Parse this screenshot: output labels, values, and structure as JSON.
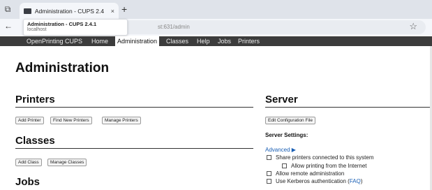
{
  "browser": {
    "tab_title": "Administration - CUPS 2.4",
    "tab_close": "×",
    "new_tab": "+",
    "tooltip_title": "Administration - CUPS 2.4.1",
    "tooltip_host": "localhost",
    "url_visible": "st:631/admin",
    "back": "←",
    "star": "☆",
    "overview": "⧉"
  },
  "nav": {
    "brand": "OpenPrinting CUPS",
    "items": [
      "Home",
      "Administration",
      "Classes",
      "Help",
      "Jobs",
      "Printers"
    ]
  },
  "page": {
    "title": "Administration"
  },
  "printers": {
    "heading": "Printers",
    "buttons": [
      "Add Printer",
      "Find New Printers",
      "Manage Printers"
    ]
  },
  "classes": {
    "heading": "Classes",
    "buttons": [
      "Add Class",
      "Manage Classes"
    ]
  },
  "jobs": {
    "heading": "Jobs"
  },
  "server": {
    "heading": "Server",
    "edit_button": "Edit Configuration File",
    "settings_label": "Server Settings:",
    "advanced": "Advanced ▶",
    "options": {
      "share": "Share printers connected to this system",
      "internet": "Allow printing from the Internet",
      "remote": "Allow remote administration",
      "kerberos": "Use Kerberos authentication (",
      "faq": "FAQ",
      "kerberos_end": ")"
    }
  }
}
